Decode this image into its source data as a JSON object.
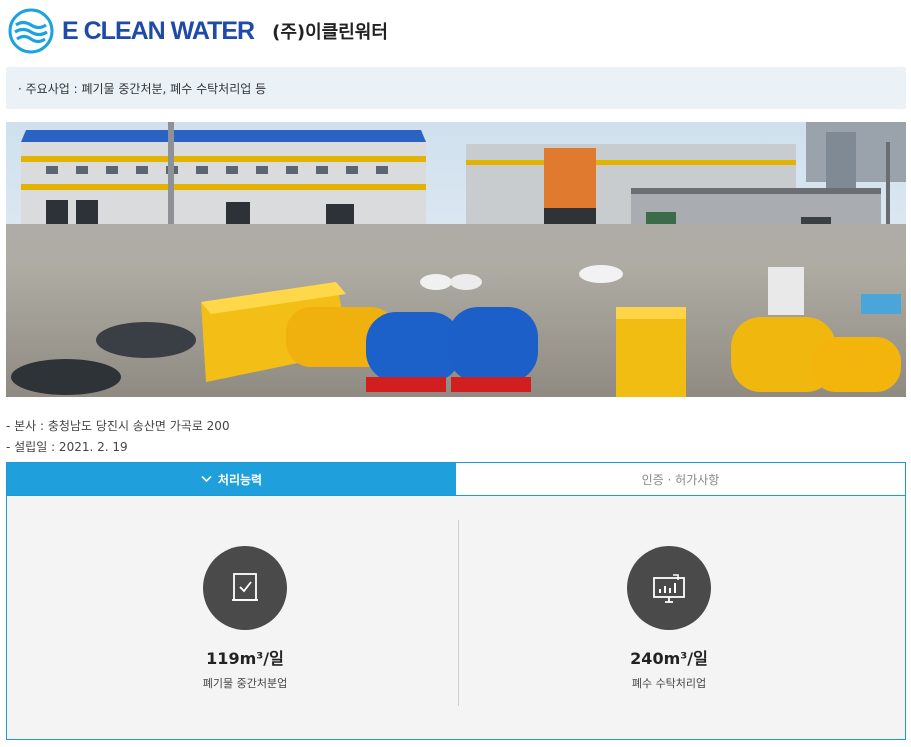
{
  "header": {
    "brand": "E CLEAN WATER",
    "company": "(주)이클린워터",
    "logo_icon": "wave-logo-icon"
  },
  "business": {
    "text": "· 주요사업 : 폐기물 중간처분, 폐수 수탁처리업 등"
  },
  "photo": {
    "icon": "facility-photo"
  },
  "info": {
    "hq": "- 본사 : 충청남도 당진시 송산면 가곡로 200",
    "established": "- 설립일 : 2021. 2. 19"
  },
  "tabs": [
    {
      "label": "처리능력",
      "active": true,
      "icon": "chevron-down-icon"
    },
    {
      "label": "인증 · 허가사항",
      "active": false
    }
  ],
  "capacity": [
    {
      "value": "119m³/일",
      "label": "폐기물 중간처분업",
      "icon": "document-check-icon"
    },
    {
      "value": "240m³/일",
      "label": "폐수 수탁처리업",
      "icon": "monitor-chart-icon"
    }
  ],
  "colors": {
    "brand": "#1f4aa8",
    "accent": "#1f9fdc",
    "info_box": "#eaf2f8",
    "panel": "#f4f4f4",
    "icon_circle": "#4a4a4a"
  }
}
